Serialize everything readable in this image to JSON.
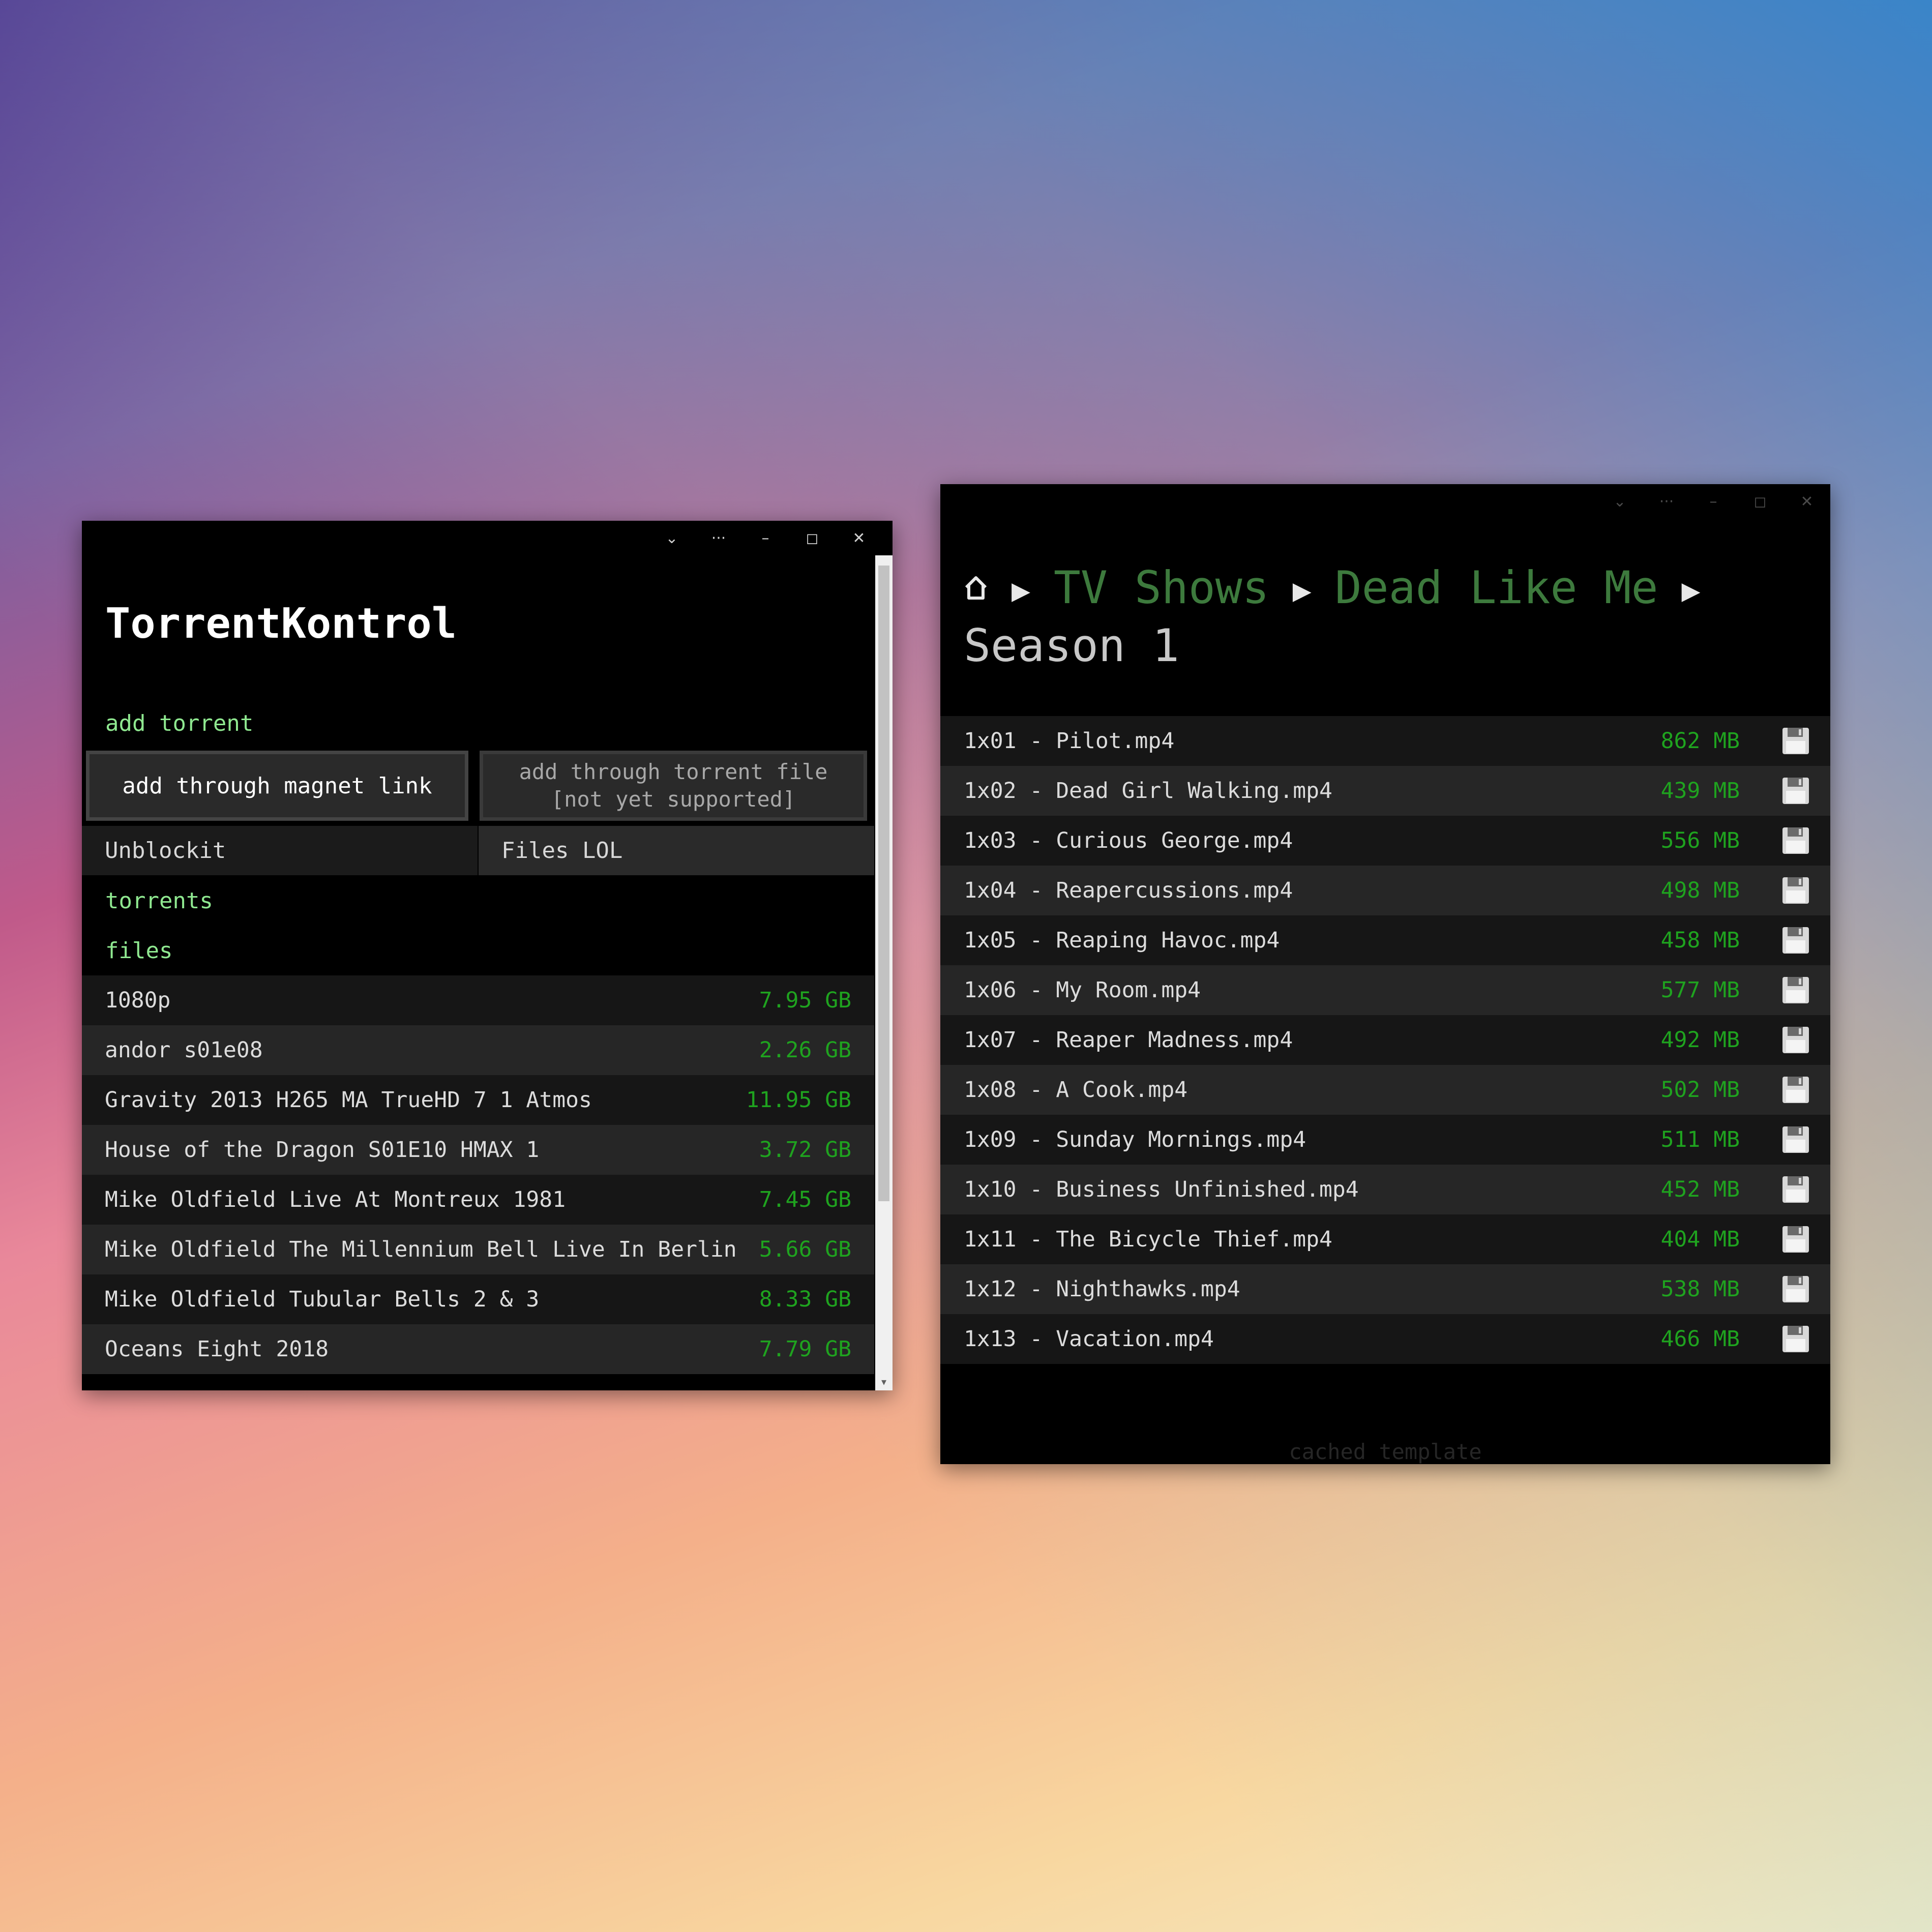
{
  "torrent_window": {
    "app_title": "TorrentKontrol",
    "titlebar": {
      "chevron": "chevron-down-icon",
      "more": "more-icon",
      "minimize": "minimize-icon",
      "maximize": "maximize-icon",
      "close": "close-icon"
    },
    "add_torrent_label": "add torrent",
    "magnet_button": "add through magnet link",
    "file_button": "add through torrent file [not yet supported]",
    "tabs": [
      "Unblockit",
      "Files LOL"
    ],
    "torrents_label": "torrents",
    "files_label": "files",
    "files": [
      {
        "name": "1080p",
        "size": "7.95 GB"
      },
      {
        "name": "andor s01e08",
        "size": "2.26 GB"
      },
      {
        "name": "Gravity 2013 H265 MA TrueHD 7 1 Atmos",
        "size": "11.95 GB"
      },
      {
        "name": "House of the Dragon S01E10 HMAX 1",
        "size": "3.72 GB"
      },
      {
        "name": "Mike Oldfield Live At Montreux 1981",
        "size": "7.45 GB"
      },
      {
        "name": "Mike Oldfield The Millennium Bell Live In Berlin",
        "size": "5.66 GB"
      },
      {
        "name": "Mike Oldfield Tubular Bells 2 & 3",
        "size": "8.33 GB"
      },
      {
        "name": "Oceans Eight 2018",
        "size": "7.79 GB"
      }
    ]
  },
  "browser_window": {
    "breadcrumb": {
      "home_icon": "home-icon",
      "items": [
        "TV Shows",
        "Dead Like Me"
      ],
      "current": "Season 1",
      "separator": "▶"
    },
    "episodes": [
      {
        "name": "1x01 - Pilot.mp4",
        "size": "862 MB"
      },
      {
        "name": "1x02 - Dead Girl Walking.mp4",
        "size": "439 MB"
      },
      {
        "name": "1x03 - Curious George.mp4",
        "size": "556 MB"
      },
      {
        "name": "1x04 - Reapercussions.mp4",
        "size": "498 MB"
      },
      {
        "name": "1x05 - Reaping Havoc.mp4",
        "size": "458 MB"
      },
      {
        "name": "1x06 - My Room.mp4",
        "size": "577 MB"
      },
      {
        "name": "1x07 - Reaper Madness.mp4",
        "size": "492 MB"
      },
      {
        "name": "1x08 - A Cook.mp4",
        "size": "502 MB"
      },
      {
        "name": "1x09 - Sunday Mornings.mp4",
        "size": "511 MB"
      },
      {
        "name": "1x10 - Business Unfinished.mp4",
        "size": "452 MB"
      },
      {
        "name": "1x11 - The Bicycle Thief.mp4",
        "size": "404 MB"
      },
      {
        "name": "1x12 - Nighthawks.mp4",
        "size": "538 MB"
      },
      {
        "name": "1x13 - Vacation.mp4",
        "size": "466 MB"
      }
    ],
    "footer": "cached template"
  },
  "colors": {
    "accent_green": "#8fe890",
    "size_green": "#1fa31f",
    "crumb_green": "#3d7a3d"
  }
}
